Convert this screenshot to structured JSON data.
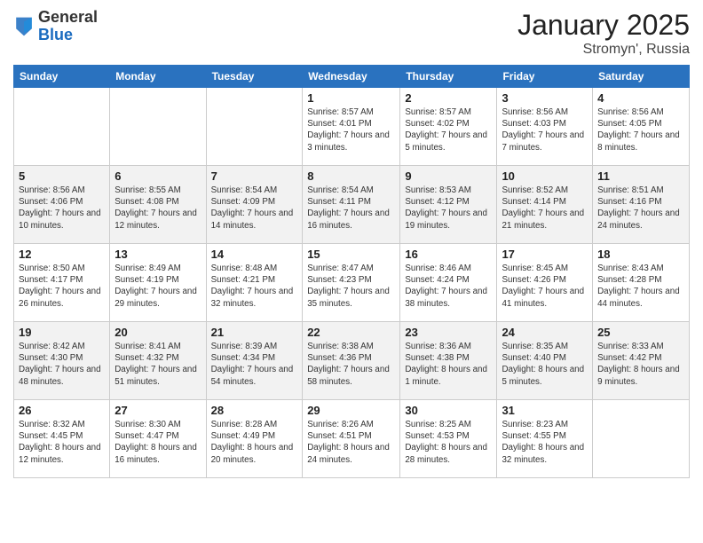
{
  "logo": {
    "general": "General",
    "blue": "Blue"
  },
  "title": "January 2025",
  "subtitle": "Stromyn', Russia",
  "days_header": [
    "Sunday",
    "Monday",
    "Tuesday",
    "Wednesday",
    "Thursday",
    "Friday",
    "Saturday"
  ],
  "weeks": [
    [
      {
        "day": "",
        "info": ""
      },
      {
        "day": "",
        "info": ""
      },
      {
        "day": "",
        "info": ""
      },
      {
        "day": "1",
        "info": "Sunrise: 8:57 AM\nSunset: 4:01 PM\nDaylight: 7 hours\nand 3 minutes."
      },
      {
        "day": "2",
        "info": "Sunrise: 8:57 AM\nSunset: 4:02 PM\nDaylight: 7 hours\nand 5 minutes."
      },
      {
        "day": "3",
        "info": "Sunrise: 8:56 AM\nSunset: 4:03 PM\nDaylight: 7 hours\nand 7 minutes."
      },
      {
        "day": "4",
        "info": "Sunrise: 8:56 AM\nSunset: 4:05 PM\nDaylight: 7 hours\nand 8 minutes."
      }
    ],
    [
      {
        "day": "5",
        "info": "Sunrise: 8:56 AM\nSunset: 4:06 PM\nDaylight: 7 hours\nand 10 minutes."
      },
      {
        "day": "6",
        "info": "Sunrise: 8:55 AM\nSunset: 4:08 PM\nDaylight: 7 hours\nand 12 minutes."
      },
      {
        "day": "7",
        "info": "Sunrise: 8:54 AM\nSunset: 4:09 PM\nDaylight: 7 hours\nand 14 minutes."
      },
      {
        "day": "8",
        "info": "Sunrise: 8:54 AM\nSunset: 4:11 PM\nDaylight: 7 hours\nand 16 minutes."
      },
      {
        "day": "9",
        "info": "Sunrise: 8:53 AM\nSunset: 4:12 PM\nDaylight: 7 hours\nand 19 minutes."
      },
      {
        "day": "10",
        "info": "Sunrise: 8:52 AM\nSunset: 4:14 PM\nDaylight: 7 hours\nand 21 minutes."
      },
      {
        "day": "11",
        "info": "Sunrise: 8:51 AM\nSunset: 4:16 PM\nDaylight: 7 hours\nand 24 minutes."
      }
    ],
    [
      {
        "day": "12",
        "info": "Sunrise: 8:50 AM\nSunset: 4:17 PM\nDaylight: 7 hours\nand 26 minutes."
      },
      {
        "day": "13",
        "info": "Sunrise: 8:49 AM\nSunset: 4:19 PM\nDaylight: 7 hours\nand 29 minutes."
      },
      {
        "day": "14",
        "info": "Sunrise: 8:48 AM\nSunset: 4:21 PM\nDaylight: 7 hours\nand 32 minutes."
      },
      {
        "day": "15",
        "info": "Sunrise: 8:47 AM\nSunset: 4:23 PM\nDaylight: 7 hours\nand 35 minutes."
      },
      {
        "day": "16",
        "info": "Sunrise: 8:46 AM\nSunset: 4:24 PM\nDaylight: 7 hours\nand 38 minutes."
      },
      {
        "day": "17",
        "info": "Sunrise: 8:45 AM\nSunset: 4:26 PM\nDaylight: 7 hours\nand 41 minutes."
      },
      {
        "day": "18",
        "info": "Sunrise: 8:43 AM\nSunset: 4:28 PM\nDaylight: 7 hours\nand 44 minutes."
      }
    ],
    [
      {
        "day": "19",
        "info": "Sunrise: 8:42 AM\nSunset: 4:30 PM\nDaylight: 7 hours\nand 48 minutes."
      },
      {
        "day": "20",
        "info": "Sunrise: 8:41 AM\nSunset: 4:32 PM\nDaylight: 7 hours\nand 51 minutes."
      },
      {
        "day": "21",
        "info": "Sunrise: 8:39 AM\nSunset: 4:34 PM\nDaylight: 7 hours\nand 54 minutes."
      },
      {
        "day": "22",
        "info": "Sunrise: 8:38 AM\nSunset: 4:36 PM\nDaylight: 7 hours\nand 58 minutes."
      },
      {
        "day": "23",
        "info": "Sunrise: 8:36 AM\nSunset: 4:38 PM\nDaylight: 8 hours\nand 1 minute."
      },
      {
        "day": "24",
        "info": "Sunrise: 8:35 AM\nSunset: 4:40 PM\nDaylight: 8 hours\nand 5 minutes."
      },
      {
        "day": "25",
        "info": "Sunrise: 8:33 AM\nSunset: 4:42 PM\nDaylight: 8 hours\nand 9 minutes."
      }
    ],
    [
      {
        "day": "26",
        "info": "Sunrise: 8:32 AM\nSunset: 4:45 PM\nDaylight: 8 hours\nand 12 minutes."
      },
      {
        "day": "27",
        "info": "Sunrise: 8:30 AM\nSunset: 4:47 PM\nDaylight: 8 hours\nand 16 minutes."
      },
      {
        "day": "28",
        "info": "Sunrise: 8:28 AM\nSunset: 4:49 PM\nDaylight: 8 hours\nand 20 minutes."
      },
      {
        "day": "29",
        "info": "Sunrise: 8:26 AM\nSunset: 4:51 PM\nDaylight: 8 hours\nand 24 minutes."
      },
      {
        "day": "30",
        "info": "Sunrise: 8:25 AM\nSunset: 4:53 PM\nDaylight: 8 hours\nand 28 minutes."
      },
      {
        "day": "31",
        "info": "Sunrise: 8:23 AM\nSunset: 4:55 PM\nDaylight: 8 hours\nand 32 minutes."
      },
      {
        "day": "",
        "info": ""
      }
    ]
  ]
}
